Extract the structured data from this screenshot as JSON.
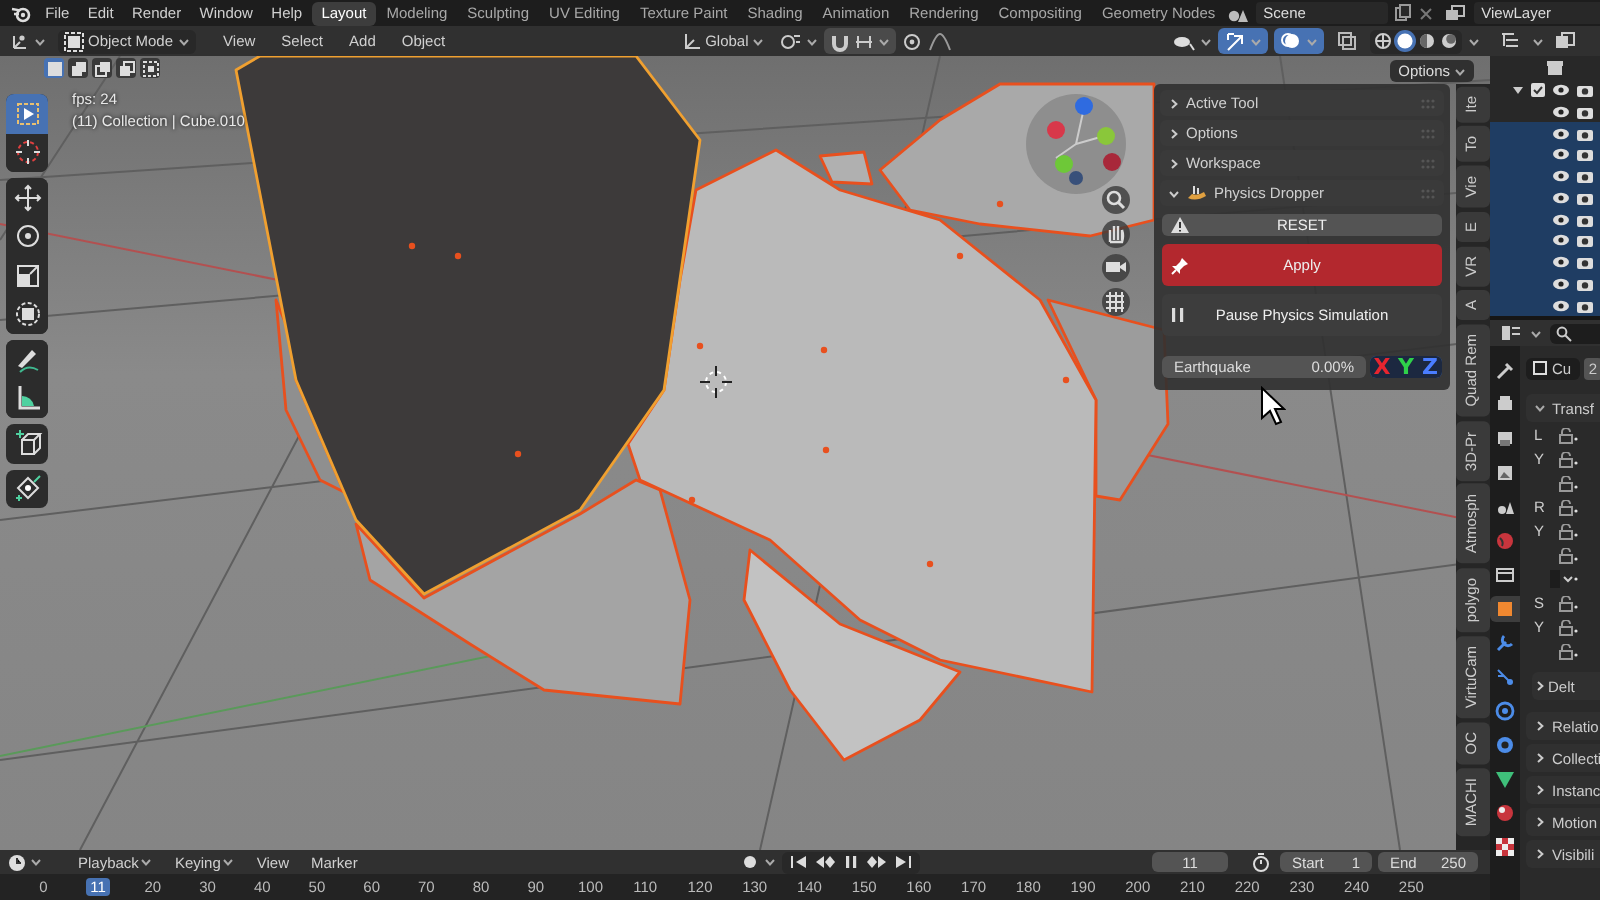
{
  "menu": [
    "File",
    "Edit",
    "Render",
    "Window",
    "Help"
  ],
  "workspaces": [
    {
      "label": "Layout",
      "selected": true
    },
    {
      "label": "Modeling",
      "selected": false
    },
    {
      "label": "Sculpting",
      "selected": false
    },
    {
      "label": "UV Editing",
      "selected": false
    },
    {
      "label": "Texture Paint",
      "selected": false
    },
    {
      "label": "Shading",
      "selected": false
    },
    {
      "label": "Animation",
      "selected": false
    },
    {
      "label": "Rendering",
      "selected": false
    },
    {
      "label": "Compositing",
      "selected": false
    },
    {
      "label": "Geometry Nodes",
      "selected": false
    }
  ],
  "scene": "Scene",
  "view_layer": "ViewLayer",
  "viewport_header": {
    "mode": "Object Mode",
    "menus": [
      "View",
      "Select",
      "Add",
      "Object"
    ],
    "orientation": "Global",
    "toggles": [
      {
        "kind": "gizmo",
        "on": true
      },
      {
        "kind": "overlay",
        "on": true
      },
      {
        "kind": "xray",
        "on": false
      }
    ],
    "shading": [
      {
        "kind": "wireframe",
        "selected": false
      },
      {
        "kind": "solid",
        "selected": true
      },
      {
        "kind": "material",
        "selected": false
      },
      {
        "kind": "rendered",
        "selected": false
      }
    ]
  },
  "select_modes": [
    {
      "kind": "set",
      "selected": true
    },
    {
      "kind": "extend",
      "selected": false
    },
    {
      "kind": "subtract",
      "selected": false
    },
    {
      "kind": "difference",
      "selected": false
    },
    {
      "kind": "intersect",
      "selected": false
    }
  ],
  "overlay_text": {
    "fps": "fps: 24",
    "object": "(11) Collection | Cube.010"
  },
  "options_button": "Options",
  "toolbar": [
    [
      {
        "kind": "select_box",
        "selected": true
      },
      {
        "kind": "cursor",
        "selected": false
      }
    ],
    [
      {
        "kind": "move",
        "selected": false
      },
      {
        "kind": "rotate",
        "selected": false
      },
      {
        "kind": "scale",
        "selected": false
      },
      {
        "kind": "transform",
        "selected": false
      }
    ],
    [
      {
        "kind": "annotate",
        "selected": false
      },
      {
        "kind": "measure",
        "selected": false
      }
    ],
    [
      {
        "kind": "add_cube",
        "selected": false
      }
    ],
    [
      {
        "kind": "shear",
        "selected": false
      }
    ]
  ],
  "sidebar_panel": {
    "sections": [
      {
        "title": "Active Tool",
        "kind": "panel",
        "expanded": false
      },
      {
        "title": "Options",
        "kind": "panel",
        "expanded": false
      },
      {
        "title": "Workspace",
        "kind": "panel",
        "expanded": false
      },
      {
        "title": "Physics Dropper",
        "kind": "addon",
        "expanded": true
      }
    ],
    "buttons": [
      {
        "kind": "reset",
        "label": "RESET"
      },
      {
        "kind": "apply",
        "label": "Apply"
      },
      {
        "kind": "pause",
        "label": "Pause Physics Simulation"
      }
    ],
    "slider": {
      "label": "Earthquake",
      "value": "0.00%",
      "level": 0
    },
    "axes": [
      {
        "label": "X",
        "color": "#e8252f",
        "selected": true
      },
      {
        "label": "Y",
        "color": "#2fd14a",
        "selected": true
      },
      {
        "label": "Z",
        "color": "#4a7dff",
        "selected": true
      }
    ]
  },
  "sidebar_tabs": [
    "Ite",
    "To",
    "Vie",
    "E",
    "VR",
    "A",
    "Quad Rem",
    "3D-Pr",
    "Atmosph",
    "polygo",
    "VirtuCam",
    "OC",
    "MACHI"
  ],
  "outliner_rows": [
    {
      "selected": false
    },
    {
      "selected": false
    },
    {
      "selected": true
    },
    {
      "selected": true
    },
    {
      "selected": true
    },
    {
      "selected": true
    },
    {
      "selected": true
    },
    {
      "selected": true
    },
    {
      "selected": true
    },
    {
      "selected": true
    },
    {
      "selected": true
    }
  ],
  "properties": {
    "tabs": [
      {
        "kind": "tool",
        "selected": false
      },
      {
        "kind": "render",
        "selected": false
      },
      {
        "kind": "output",
        "selected": false
      },
      {
        "kind": "view_layer",
        "selected": false
      },
      {
        "kind": "scene",
        "selected": false
      },
      {
        "kind": "world",
        "selected": false
      },
      {
        "kind": "collection",
        "selected": false
      },
      {
        "kind": "object",
        "selected": true
      },
      {
        "kind": "modifier",
        "selected": false
      },
      {
        "kind": "particles",
        "selected": false
      },
      {
        "kind": "physics",
        "selected": false
      },
      {
        "kind": "constraints",
        "selected": false
      },
      {
        "kind": "data",
        "selected": false
      },
      {
        "kind": "material",
        "selected": false
      },
      {
        "kind": "texture",
        "selected": false
      }
    ],
    "object_name": "Cu",
    "users": "2",
    "transform": {
      "title": "Transf",
      "groups": [
        [
          "L",
          "Y"
        ],
        [
          "R",
          "Y"
        ],
        [
          "S",
          "Y"
        ]
      ],
      "subsection": "Delt"
    },
    "sections": [
      "Relatio",
      "Collecti",
      "Instanc",
      "Motion",
      "Visibili"
    ]
  },
  "timeline": {
    "menus": [
      "Playback",
      "Keying",
      "View",
      "Marker"
    ],
    "current_frame": "11",
    "start": {
      "label": "Start",
      "value": "1"
    },
    "end": {
      "label": "End",
      "value": "250"
    },
    "ruler": [
      {
        "label": "0",
        "selected": false
      },
      {
        "label": "11",
        "selected": true
      },
      {
        "label": "20",
        "selected": false
      },
      {
        "label": "30",
        "selected": false
      },
      {
        "label": "40",
        "selected": false
      },
      {
        "label": "50",
        "selected": false
      },
      {
        "label": "60",
        "selected": false
      },
      {
        "label": "70",
        "selected": false
      },
      {
        "label": "80",
        "selected": false
      },
      {
        "label": "90",
        "selected": false
      },
      {
        "label": "100",
        "selected": false
      },
      {
        "label": "110",
        "selected": false
      },
      {
        "label": "120",
        "selected": false
      },
      {
        "label": "130",
        "selected": false
      },
      {
        "label": "140",
        "selected": false
      },
      {
        "label": "150",
        "selected": false
      },
      {
        "label": "160",
        "selected": false
      },
      {
        "label": "170",
        "selected": false
      },
      {
        "label": "180",
        "selected": false
      },
      {
        "label": "190",
        "selected": false
      },
      {
        "label": "200",
        "selected": false
      },
      {
        "label": "210",
        "selected": false
      },
      {
        "label": "220",
        "selected": false
      },
      {
        "label": "230",
        "selected": false
      },
      {
        "label": "240",
        "selected": false
      },
      {
        "label": "250",
        "selected": false
      }
    ]
  }
}
